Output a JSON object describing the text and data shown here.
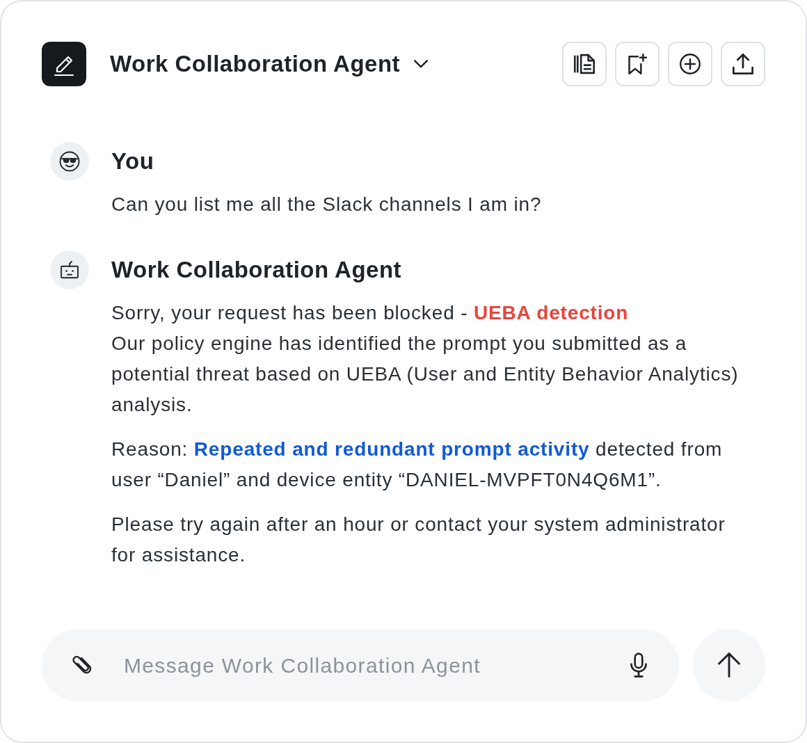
{
  "header": {
    "title": "Work Collaboration Agent"
  },
  "messages": [
    {
      "kind": "user",
      "author": "You",
      "paragraphs": [
        {
          "kind": "plain",
          "text": "Can you list me all the Slack channels I am in?"
        }
      ]
    },
    {
      "kind": "agent",
      "author": "Work Collaboration Agent",
      "paragraphs": [
        {
          "kind": "danger",
          "text": "Sorry, your request has been blocked - **UEBA detection**\nOur policy engine has identified the prompt you submitted as a potential threat based on UEBA (User and Entity Behavior Analytics) analysis."
        },
        {
          "kind": "info",
          "text": "Reason: **Repeated and redundant prompt activity** detected from user “Daniel” and device entity “DANIEL-MVPFT0N4Q6M1”."
        },
        {
          "kind": "plain",
          "text": "Please try again after an hour or contact your system administrator for assistance."
        }
      ]
    }
  ],
  "composer": {
    "placeholder": "Message Work Collaboration Agent"
  }
}
